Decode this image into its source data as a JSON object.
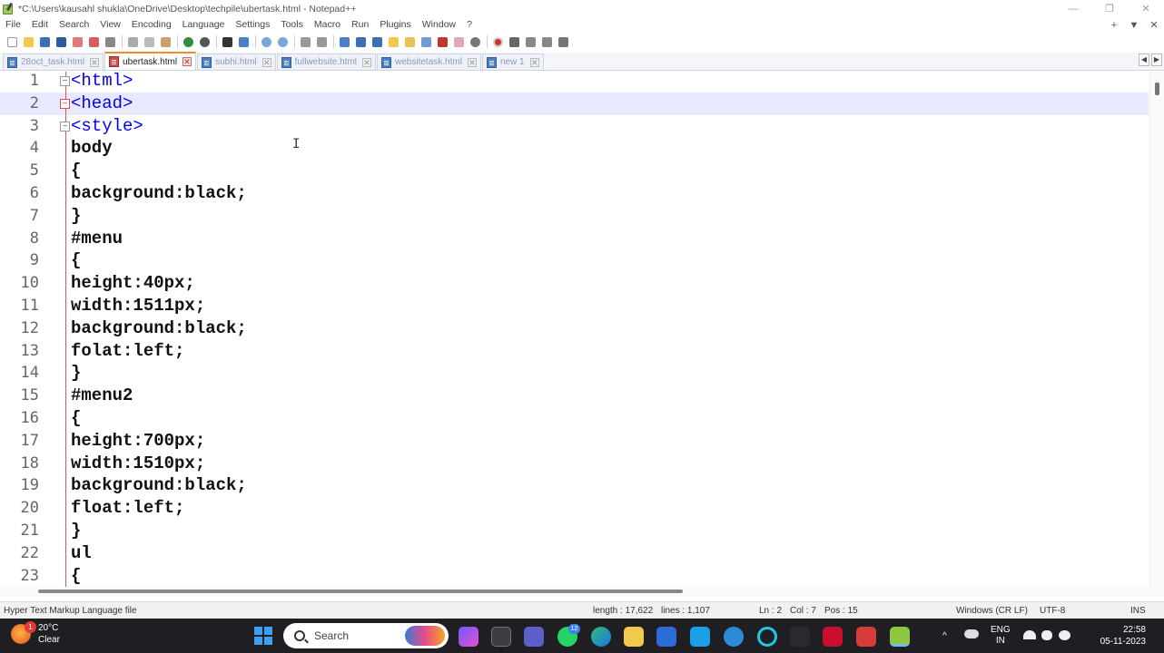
{
  "window": {
    "title": "*C:\\Users\\kausahl shukla\\OneDrive\\Desktop\\techpile\\ubertask.html - Notepad++",
    "minimize": "—",
    "restore": "❐",
    "close": "✕"
  },
  "menu": {
    "items": [
      "File",
      "Edit",
      "Search",
      "View",
      "Encoding",
      "Language",
      "Settings",
      "Tools",
      "Macro",
      "Run",
      "Plugins",
      "Window",
      "?"
    ],
    "add_tab": "+",
    "list_tabs": "▼",
    "close_doc": "✕"
  },
  "tabs": [
    {
      "label": "28oct_task.html",
      "active": false
    },
    {
      "label": "ubertask.html",
      "active": true
    },
    {
      "label": "subhi.html",
      "active": false
    },
    {
      "label": "fullwebsite.html",
      "active": false
    },
    {
      "label": "websitetask.html",
      "active": false
    },
    {
      "label": "new 1",
      "active": false
    }
  ],
  "tab_nav": {
    "left": "◀",
    "right": "▶"
  },
  "editor": {
    "current_line": 2,
    "lines": [
      {
        "n": "1",
        "text": "<html>",
        "tag": true,
        "fold": "minus"
      },
      {
        "n": "2",
        "text": "<head>",
        "tag": true,
        "fold": "minus-red"
      },
      {
        "n": "3",
        "text": "<style>",
        "tag": true,
        "fold": "minus"
      },
      {
        "n": "4",
        "text": "body"
      },
      {
        "n": "5",
        "text": "{"
      },
      {
        "n": "6",
        "text": "background:black;"
      },
      {
        "n": "7",
        "text": "}"
      },
      {
        "n": "8",
        "text": "#menu"
      },
      {
        "n": "9",
        "text": "{"
      },
      {
        "n": "10",
        "text": "height:40px;"
      },
      {
        "n": "11",
        "text": "width:1511px;"
      },
      {
        "n": "12",
        "text": "background:black;"
      },
      {
        "n": "13",
        "text": "folat:left;"
      },
      {
        "n": "14",
        "text": "}"
      },
      {
        "n": "15",
        "text": "#menu2"
      },
      {
        "n": "16",
        "text": "{"
      },
      {
        "n": "17",
        "text": "height:700px;"
      },
      {
        "n": "18",
        "text": "width:1510px;"
      },
      {
        "n": "19",
        "text": "background:black;"
      },
      {
        "n": "20",
        "text": "float:left;"
      },
      {
        "n": "21",
        "text": "}"
      },
      {
        "n": "22",
        "text": "ul"
      },
      {
        "n": "23",
        "text": "{"
      }
    ],
    "mouse_cursor": "I"
  },
  "status": {
    "filetype": "Hyper Text Markup Language file",
    "length": "length : 17,622",
    "lines": "lines : 1,107",
    "ln": "Ln : 2",
    "col": "Col : 7",
    "pos": "Pos : 15",
    "eol": "Windows (CR LF)",
    "encoding": "UTF-8",
    "mode": "INS"
  },
  "taskbar": {
    "weather_temp": "20°C",
    "weather_cond": "Clear",
    "weather_badge": "1",
    "search_label": "Search",
    "whatsapp_badge": "12",
    "lang_line1": "ENG",
    "lang_line2": "IN",
    "time": "22:58",
    "date": "05-11-2023",
    "tray_chevron": "^"
  },
  "colors": {
    "tag_blue": "#0000ff",
    "current_line": "#e8e8ff",
    "active_tab_accent": "#f28c28",
    "fold_red": "#f05050",
    "taskbar_bg": "#1f1f23"
  }
}
